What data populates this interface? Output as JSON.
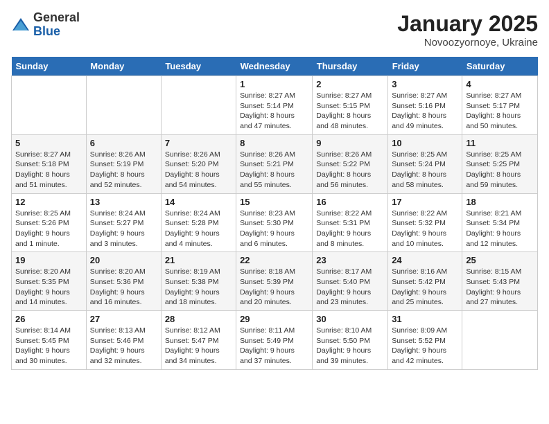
{
  "logo": {
    "general": "General",
    "blue": "Blue"
  },
  "title": "January 2025",
  "location": "Novoozyornoye, Ukraine",
  "weekdays": [
    "Sunday",
    "Monday",
    "Tuesday",
    "Wednesday",
    "Thursday",
    "Friday",
    "Saturday"
  ],
  "weeks": [
    [
      null,
      null,
      null,
      {
        "day": "1",
        "sunrise": "Sunrise: 8:27 AM",
        "sunset": "Sunset: 5:14 PM",
        "daylight": "Daylight: 8 hours and 47 minutes."
      },
      {
        "day": "2",
        "sunrise": "Sunrise: 8:27 AM",
        "sunset": "Sunset: 5:15 PM",
        "daylight": "Daylight: 8 hours and 48 minutes."
      },
      {
        "day": "3",
        "sunrise": "Sunrise: 8:27 AM",
        "sunset": "Sunset: 5:16 PM",
        "daylight": "Daylight: 8 hours and 49 minutes."
      },
      {
        "day": "4",
        "sunrise": "Sunrise: 8:27 AM",
        "sunset": "Sunset: 5:17 PM",
        "daylight": "Daylight: 8 hours and 50 minutes."
      }
    ],
    [
      {
        "day": "5",
        "sunrise": "Sunrise: 8:27 AM",
        "sunset": "Sunset: 5:18 PM",
        "daylight": "Daylight: 8 hours and 51 minutes."
      },
      {
        "day": "6",
        "sunrise": "Sunrise: 8:26 AM",
        "sunset": "Sunset: 5:19 PM",
        "daylight": "Daylight: 8 hours and 52 minutes."
      },
      {
        "day": "7",
        "sunrise": "Sunrise: 8:26 AM",
        "sunset": "Sunset: 5:20 PM",
        "daylight": "Daylight: 8 hours and 54 minutes."
      },
      {
        "day": "8",
        "sunrise": "Sunrise: 8:26 AM",
        "sunset": "Sunset: 5:21 PM",
        "daylight": "Daylight: 8 hours and 55 minutes."
      },
      {
        "day": "9",
        "sunrise": "Sunrise: 8:26 AM",
        "sunset": "Sunset: 5:22 PM",
        "daylight": "Daylight: 8 hours and 56 minutes."
      },
      {
        "day": "10",
        "sunrise": "Sunrise: 8:25 AM",
        "sunset": "Sunset: 5:24 PM",
        "daylight": "Daylight: 8 hours and 58 minutes."
      },
      {
        "day": "11",
        "sunrise": "Sunrise: 8:25 AM",
        "sunset": "Sunset: 5:25 PM",
        "daylight": "Daylight: 8 hours and 59 minutes."
      }
    ],
    [
      {
        "day": "12",
        "sunrise": "Sunrise: 8:25 AM",
        "sunset": "Sunset: 5:26 PM",
        "daylight": "Daylight: 9 hours and 1 minute."
      },
      {
        "day": "13",
        "sunrise": "Sunrise: 8:24 AM",
        "sunset": "Sunset: 5:27 PM",
        "daylight": "Daylight: 9 hours and 3 minutes."
      },
      {
        "day": "14",
        "sunrise": "Sunrise: 8:24 AM",
        "sunset": "Sunset: 5:28 PM",
        "daylight": "Daylight: 9 hours and 4 minutes."
      },
      {
        "day": "15",
        "sunrise": "Sunrise: 8:23 AM",
        "sunset": "Sunset: 5:30 PM",
        "daylight": "Daylight: 9 hours and 6 minutes."
      },
      {
        "day": "16",
        "sunrise": "Sunrise: 8:22 AM",
        "sunset": "Sunset: 5:31 PM",
        "daylight": "Daylight: 9 hours and 8 minutes."
      },
      {
        "day": "17",
        "sunrise": "Sunrise: 8:22 AM",
        "sunset": "Sunset: 5:32 PM",
        "daylight": "Daylight: 9 hours and 10 minutes."
      },
      {
        "day": "18",
        "sunrise": "Sunrise: 8:21 AM",
        "sunset": "Sunset: 5:34 PM",
        "daylight": "Daylight: 9 hours and 12 minutes."
      }
    ],
    [
      {
        "day": "19",
        "sunrise": "Sunrise: 8:20 AM",
        "sunset": "Sunset: 5:35 PM",
        "daylight": "Daylight: 9 hours and 14 minutes."
      },
      {
        "day": "20",
        "sunrise": "Sunrise: 8:20 AM",
        "sunset": "Sunset: 5:36 PM",
        "daylight": "Daylight: 9 hours and 16 minutes."
      },
      {
        "day": "21",
        "sunrise": "Sunrise: 8:19 AM",
        "sunset": "Sunset: 5:38 PM",
        "daylight": "Daylight: 9 hours and 18 minutes."
      },
      {
        "day": "22",
        "sunrise": "Sunrise: 8:18 AM",
        "sunset": "Sunset: 5:39 PM",
        "daylight": "Daylight: 9 hours and 20 minutes."
      },
      {
        "day": "23",
        "sunrise": "Sunrise: 8:17 AM",
        "sunset": "Sunset: 5:40 PM",
        "daylight": "Daylight: 9 hours and 23 minutes."
      },
      {
        "day": "24",
        "sunrise": "Sunrise: 8:16 AM",
        "sunset": "Sunset: 5:42 PM",
        "daylight": "Daylight: 9 hours and 25 minutes."
      },
      {
        "day": "25",
        "sunrise": "Sunrise: 8:15 AM",
        "sunset": "Sunset: 5:43 PM",
        "daylight": "Daylight: 9 hours and 27 minutes."
      }
    ],
    [
      {
        "day": "26",
        "sunrise": "Sunrise: 8:14 AM",
        "sunset": "Sunset: 5:45 PM",
        "daylight": "Daylight: 9 hours and 30 minutes."
      },
      {
        "day": "27",
        "sunrise": "Sunrise: 8:13 AM",
        "sunset": "Sunset: 5:46 PM",
        "daylight": "Daylight: 9 hours and 32 minutes."
      },
      {
        "day": "28",
        "sunrise": "Sunrise: 8:12 AM",
        "sunset": "Sunset: 5:47 PM",
        "daylight": "Daylight: 9 hours and 34 minutes."
      },
      {
        "day": "29",
        "sunrise": "Sunrise: 8:11 AM",
        "sunset": "Sunset: 5:49 PM",
        "daylight": "Daylight: 9 hours and 37 minutes."
      },
      {
        "day": "30",
        "sunrise": "Sunrise: 8:10 AM",
        "sunset": "Sunset: 5:50 PM",
        "daylight": "Daylight: 9 hours and 39 minutes."
      },
      {
        "day": "31",
        "sunrise": "Sunrise: 8:09 AM",
        "sunset": "Sunset: 5:52 PM",
        "daylight": "Daylight: 9 hours and 42 minutes."
      },
      null
    ]
  ]
}
